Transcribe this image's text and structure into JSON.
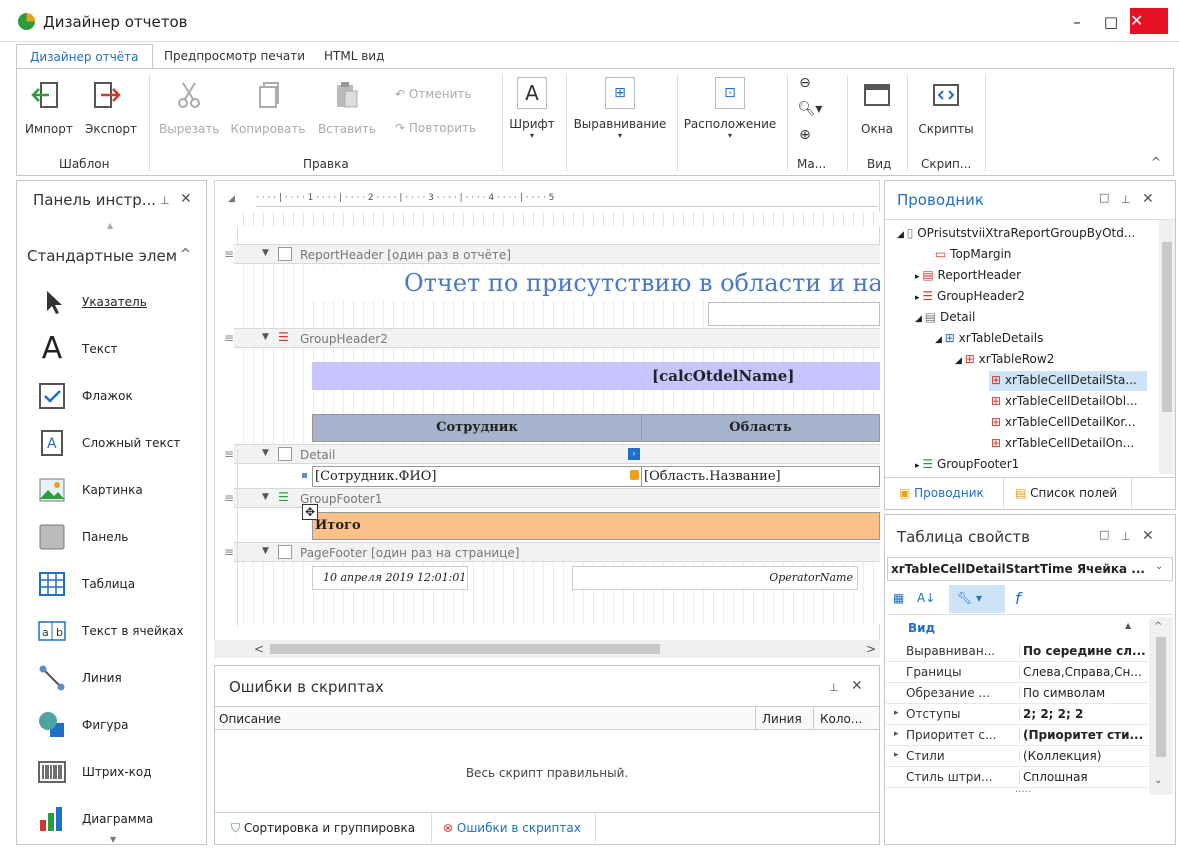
{
  "window": {
    "title": "Дизайнер отчетов",
    "minimize": "–",
    "maximize": "□",
    "close": "✕"
  },
  "tabs": [
    "Дизайнер отчёта",
    "Предпросмотр печати",
    "HTML вид"
  ],
  "ribbon": {
    "import": "Импорт",
    "export": "Экспорт",
    "group_template": "Шаблон",
    "cut": "Вырезать",
    "copy": "Копировать",
    "paste": "Вставить",
    "undo": "Отменить",
    "redo": "Повторить",
    "group_edit": "Правка",
    "font": "Шрифт",
    "align": "Выравнивание",
    "layout": "Расположение",
    "group_zoom": "Ма...",
    "windows": "Окна",
    "group_view": "Вид",
    "scripts": "Скрипты",
    "group_scripts": "Скрип...",
    "collapse": "^"
  },
  "toolbox": {
    "title": "Панель инстр...",
    "section": "Стандартные элем",
    "items": [
      "Указатель",
      "Текст",
      "Флажок",
      "Сложный текст",
      "Картинка",
      "Панель",
      "Таблица",
      "Текст в ячейках",
      "Линия",
      "Фигура",
      "Штрих-код",
      "Диаграмма"
    ]
  },
  "designer": {
    "ruler": "· · · · | · · · · 1 · · · · | · · · · 2 · · · · | · · · · 3 · · · · | · · · · 4 · · · · | · · · · 5",
    "bands": {
      "report_header": "ReportHeader [один раз в отчёте]",
      "group_header": "GroupHeader2",
      "detail": "Detail",
      "group_footer": "GroupFooter1",
      "page_footer": "PageFooter [один раз на странице]"
    },
    "report_title": "Отчет по присутствию в области и на ра",
    "calc_field": "[calcOtdelName]",
    "col_employee": "Сотрудник",
    "col_area": "Область",
    "cell_fio": "[Сотрудник.ФИО]",
    "cell_area": "[Область.Название]",
    "total": "Итого",
    "footer_date": "10 апреля 2019 12:01:01",
    "footer_operator": "OperatorName"
  },
  "errors": {
    "title": "Ошибки в скриптах",
    "col_desc": "Описание",
    "col_line": "Линия",
    "col_col": "Коло...",
    "message": "Весь скрипт правильный.",
    "tab_sort": "Сортировка и группировка",
    "tab_errors": "Ошибки в скриптах"
  },
  "explorer": {
    "title": "Проводник",
    "nodes": [
      "OPrisutstviiXtraReportGroupByOtd...",
      "TopMargin",
      "ReportHeader",
      "GroupHeader2",
      "Detail",
      "xrTableDetails",
      "xrTableRow2",
      "xrTableCellDetailSta...",
      "xrTableCellDetailObl...",
      "xrTableCellDetailKor...",
      "xrTableCellDetailOn...",
      "GroupFooter1"
    ],
    "tab_explorer": "Проводник",
    "tab_fields": "Список полей"
  },
  "props": {
    "title": "Таблица свойств",
    "selector": "xrTableCellDetailStartTime  Ячейка ...",
    "category": "Вид",
    "rows": [
      {
        "name": "Выравниван...",
        "value": "По середине сл...",
        "bold": true
      },
      {
        "name": "Границы",
        "value": "Слева,Справа,Сн...",
        "bold": false
      },
      {
        "name": "Обрезание ...",
        "value": "По символам",
        "bold": false
      },
      {
        "name": "Отступы",
        "value": "2; 2; 2; 2",
        "bold": true
      },
      {
        "name": "Приоритет с...",
        "value": "(Приоритет сти...",
        "bold": true
      },
      {
        "name": "Стили",
        "value": "(Коллекция)",
        "bold": false
      },
      {
        "name": "Стиль штри...",
        "value": "Сплошная",
        "bold": false
      }
    ]
  }
}
